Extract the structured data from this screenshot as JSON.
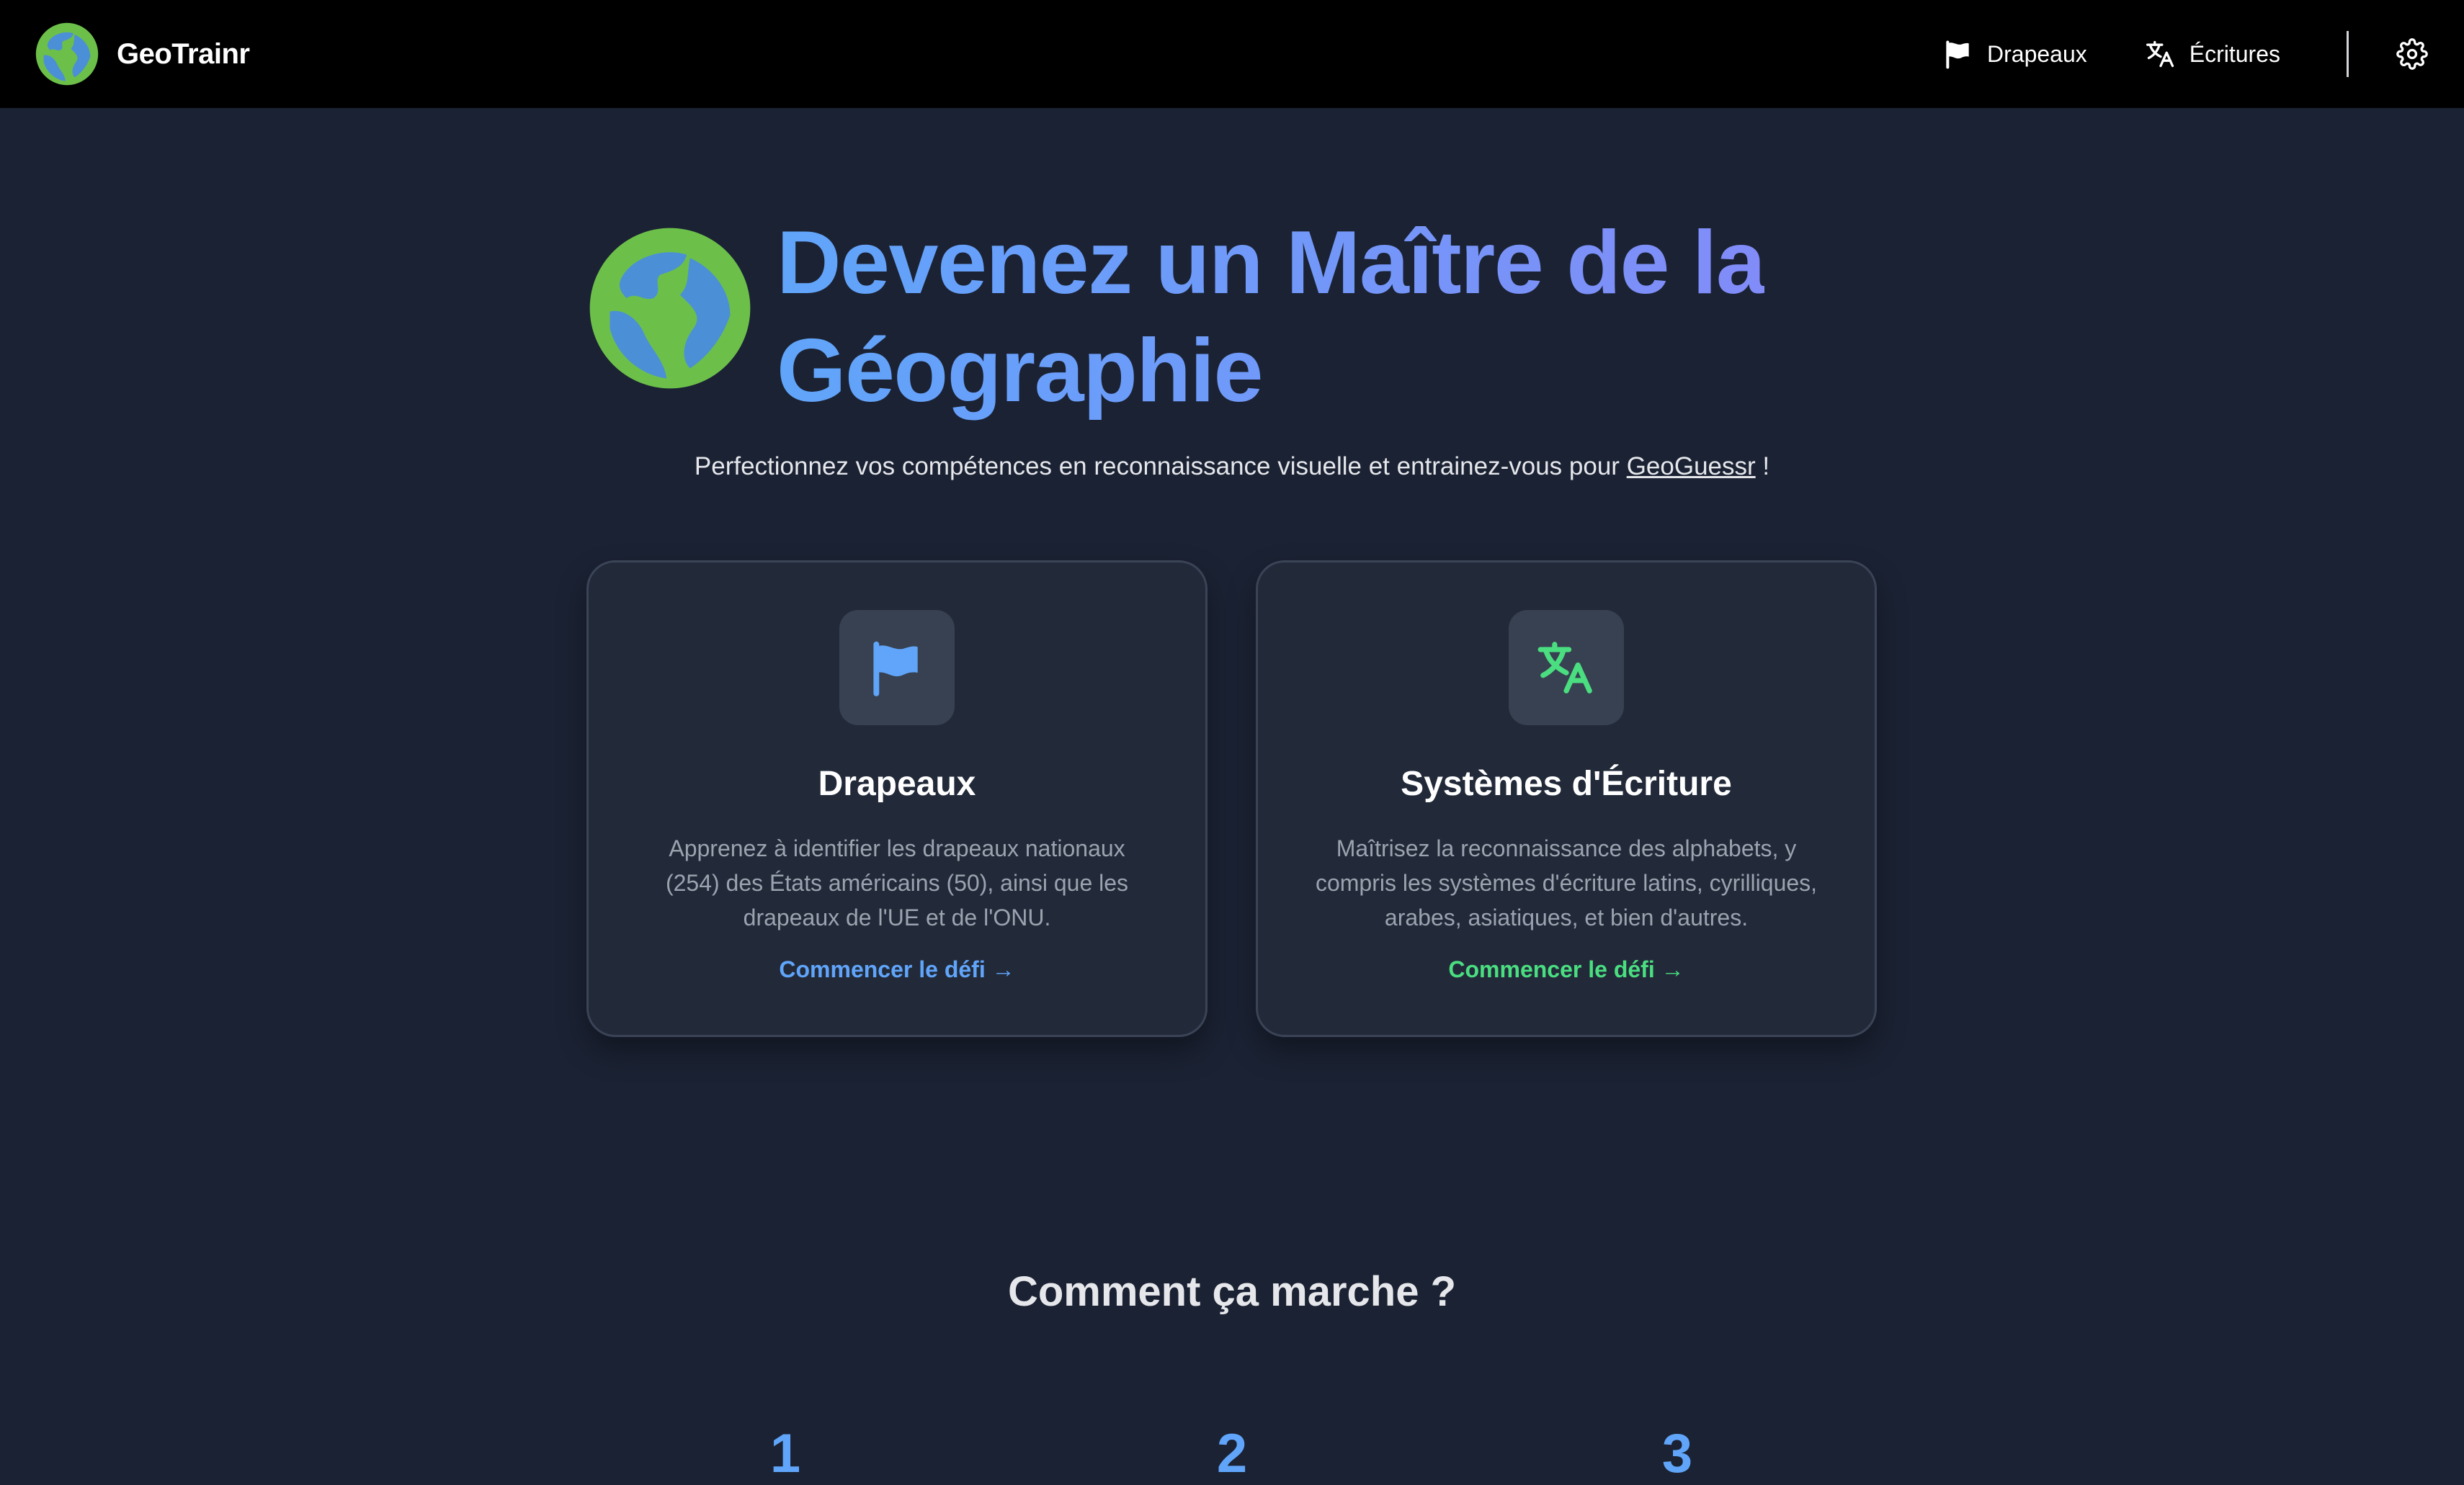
{
  "navbar": {
    "brand": "GeoTrainr",
    "links": [
      {
        "label": "Drapeaux",
        "icon": "flag-icon"
      },
      {
        "label": "Écritures",
        "icon": "translate-icon"
      }
    ],
    "settings_icon": "gear-icon"
  },
  "hero": {
    "title_line1": "Devenez un Maître de la",
    "title_line2": "Géographie",
    "subtitle_before": "Perfectionnez vos compétences en reconnaissance visuelle et entrainez-vous pour ",
    "subtitle_link": "GeoGuessr",
    "subtitle_after": " !"
  },
  "cards": [
    {
      "icon": "flag-icon",
      "title": "Drapeaux",
      "description": "Apprenez à identifier les drapeaux nationaux (254) des États américains (50), ainsi que les drapeaux de l'UE et de l'ONU.",
      "cta": "Commencer le défi →",
      "accent": "#60a5fa"
    },
    {
      "icon": "translate-icon",
      "title": "Systèmes d'Écriture",
      "description": "Maîtrisez la reconnaissance des alphabets, y compris les systèmes d'écriture latins, cyrilliques, arabes, asiatiques, et bien d'autres.",
      "cta": "Commencer le défi →",
      "accent": "#4ade80"
    }
  ],
  "how_it_works": {
    "title": "Comment ça marche ?",
    "steps": [
      "1",
      "2",
      "3"
    ]
  },
  "colors": {
    "background": "#1b2233",
    "navbar": "#000000",
    "card": "#222a3a",
    "accent_blue": "#60a5fa",
    "accent_indigo": "#818cf8",
    "accent_green": "#4ade80",
    "globe_land": "#6cc04a",
    "globe_water": "#4b8fd6"
  }
}
